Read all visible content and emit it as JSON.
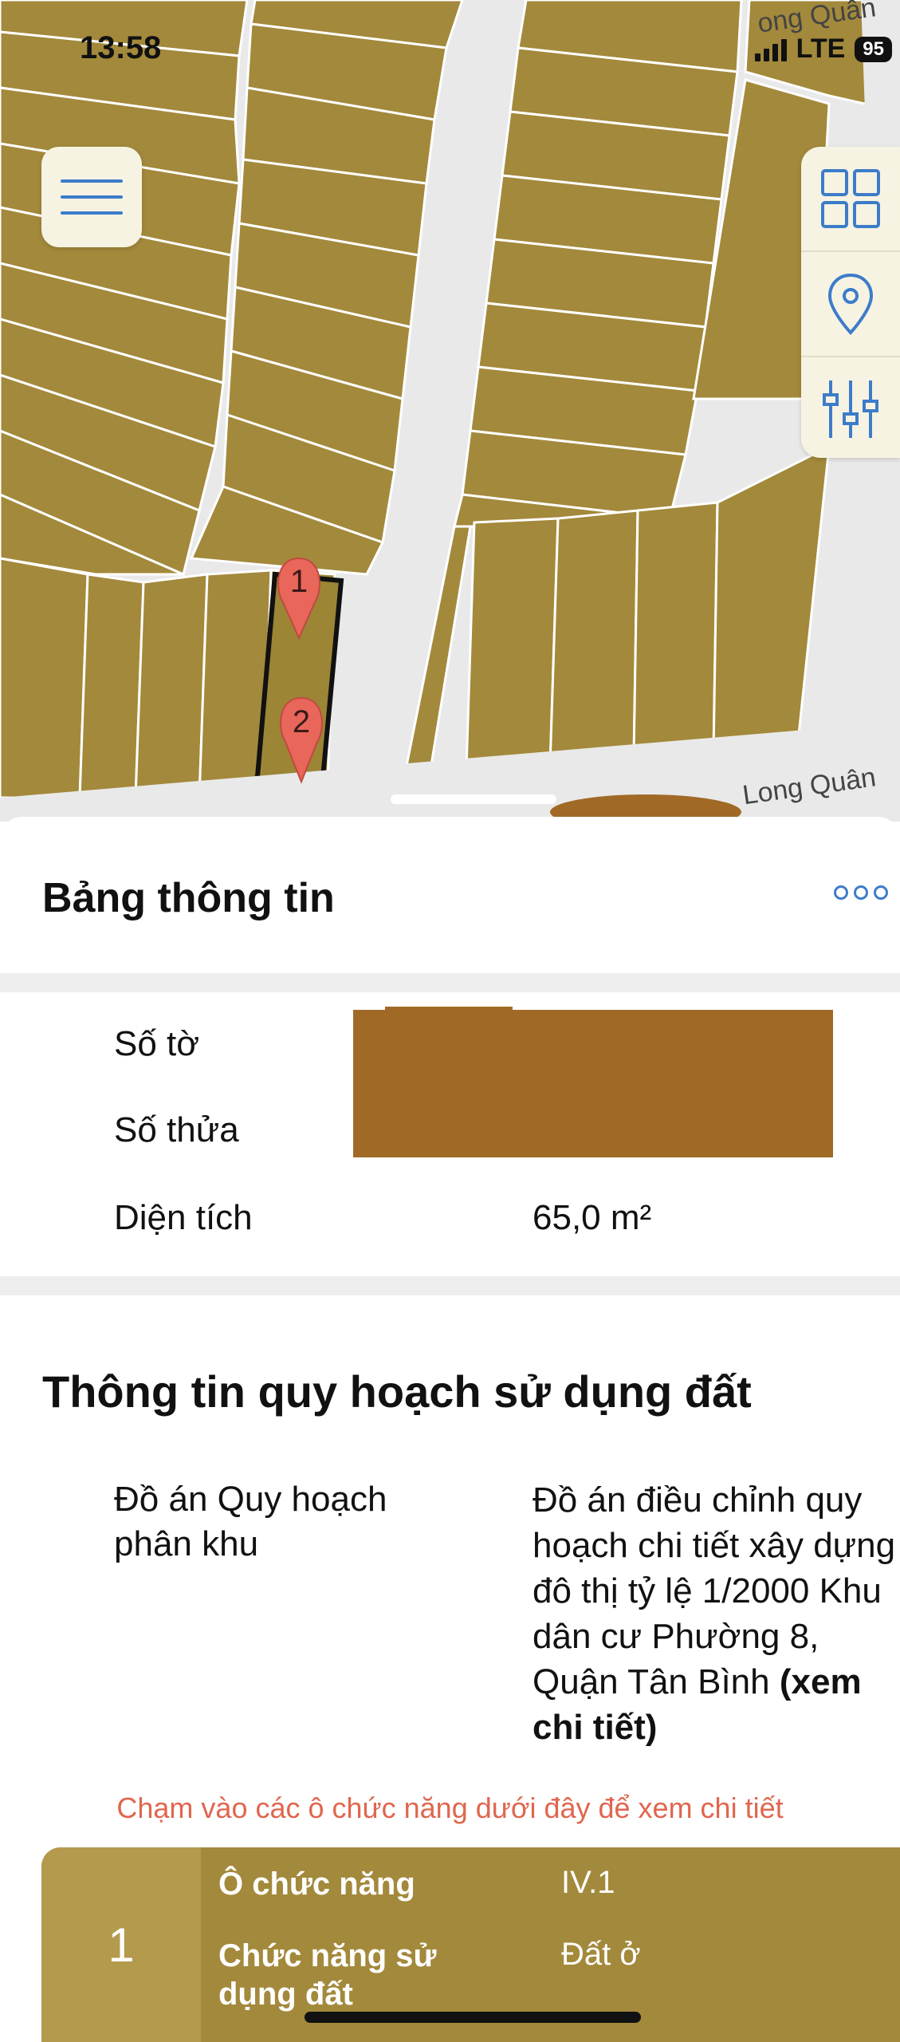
{
  "status_bar": {
    "time": "13:58",
    "network": "LTE",
    "battery": "95"
  },
  "map": {
    "street_label_top": "ong Quân",
    "street_label_bottom": "Long Quân",
    "marker_1": "1",
    "marker_2": "2",
    "land_color": "#a3893b",
    "road_color": "#e9e9e9"
  },
  "map_controls": {
    "menu_icon": "hamburger-icon",
    "tools": [
      "grid-icon",
      "location-pin-icon",
      "sliders-icon"
    ]
  },
  "info_panel": {
    "title": "Bảng thông tin",
    "more_icon": "more-dots-icon",
    "rows": [
      {
        "label": "Số tờ",
        "value": ""
      },
      {
        "label": "Số thửa",
        "value": ""
      },
      {
        "label": "Diện tích",
        "value": "65,0 m²"
      }
    ]
  },
  "planning": {
    "title": "Thông tin quy hoạch sử dụng đất",
    "plan_label": "Đồ án Quy hoạch phân khu",
    "plan_value": "Đồ án điều chỉnh quy hoạch chi tiết xây dựng đô thị tỷ lệ 1/2000 Khu dân cư Phường 8, Quận Tân Bình",
    "plan_link": "(xem chi tiết)",
    "hint": "Chạm vào các ô chức năng dưới đây để xem chi tiết"
  },
  "function_card": {
    "index": "1",
    "cell_label": "Ô chức năng",
    "cell_value": "IV.1",
    "use_label": "Chức năng sử dụng đất",
    "use_value": "Đất ở",
    "color": "#a3893b"
  }
}
